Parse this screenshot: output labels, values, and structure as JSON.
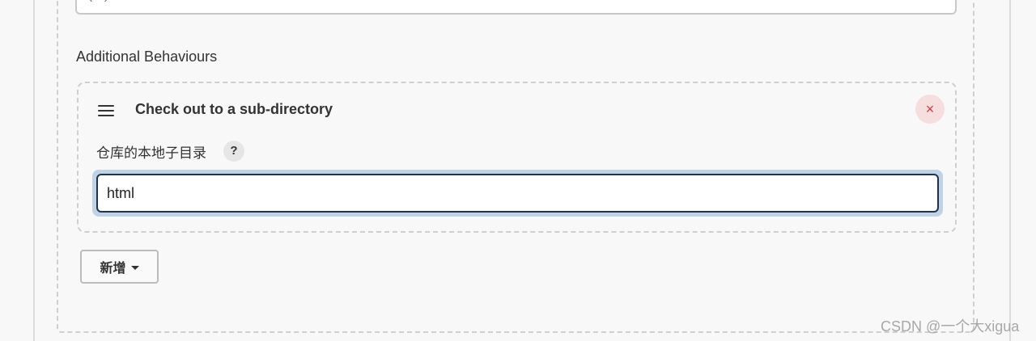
{
  "top_field": {
    "partial_value": "(---)"
  },
  "additional_behaviours": {
    "section_label": "Additional Behaviours",
    "card": {
      "title": "Check out to a sub-directory",
      "delete_symbol": "×",
      "field_label": "仓库的本地子目录",
      "help_symbol": "?",
      "input_value": "html",
      "icons": {
        "drag": "drag-handle-icon",
        "delete": "close-icon",
        "help": "help-icon"
      }
    },
    "add_button_label": "新增"
  },
  "watermark": "CSDN @一个大xigua",
  "colors": {
    "background": "#f8f8f8",
    "delete_bg": "#f7dede",
    "delete_fg": "#d63c3c",
    "focus_ring": "#bfd3e6",
    "input_border": "#20334a"
  }
}
